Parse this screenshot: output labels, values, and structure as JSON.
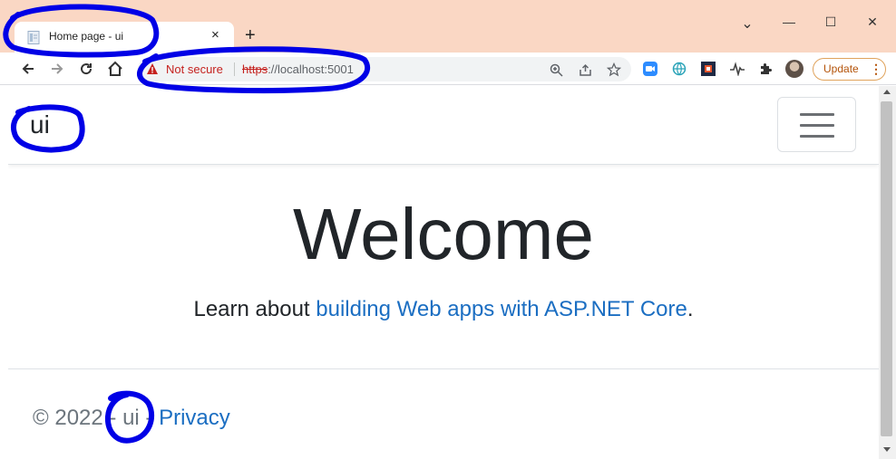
{
  "browser": {
    "tab": {
      "title": "Home page - ui",
      "close_icon": "×",
      "favicon": "document-icon"
    },
    "new_tab_icon": "+",
    "window_controls": {
      "chevron": "⌄",
      "minimize": "—",
      "maximize": "☐",
      "close": "✕"
    },
    "nav": {
      "back_icon": "arrow-left-icon",
      "forward_icon": "arrow-right-icon",
      "reload_icon": "reload-icon",
      "home_icon": "home-icon"
    },
    "omnibox": {
      "security_label": "Not secure",
      "url_scheme": "https",
      "url_rest": "://localhost:5001"
    },
    "update_button": {
      "label": "Update",
      "menu_icon": "⋮"
    },
    "colors": {
      "tabstrip": "#fad7c4",
      "warning": "#c5221f",
      "update": "#b45309"
    }
  },
  "page": {
    "brand": "ui",
    "heading": "Welcome",
    "lead_prefix": "Learn about ",
    "lead_link": "building Web apps with ASP.NET Core",
    "lead_suffix": ".",
    "footer": {
      "copyright": "© 2022 - ui - ",
      "privacy_link": "Privacy"
    },
    "colors": {
      "link": "#1b6ec2",
      "text": "#212529",
      "muted": "#6c757d"
    }
  },
  "annotations": {
    "color": "#0000e6",
    "count": 4
  }
}
